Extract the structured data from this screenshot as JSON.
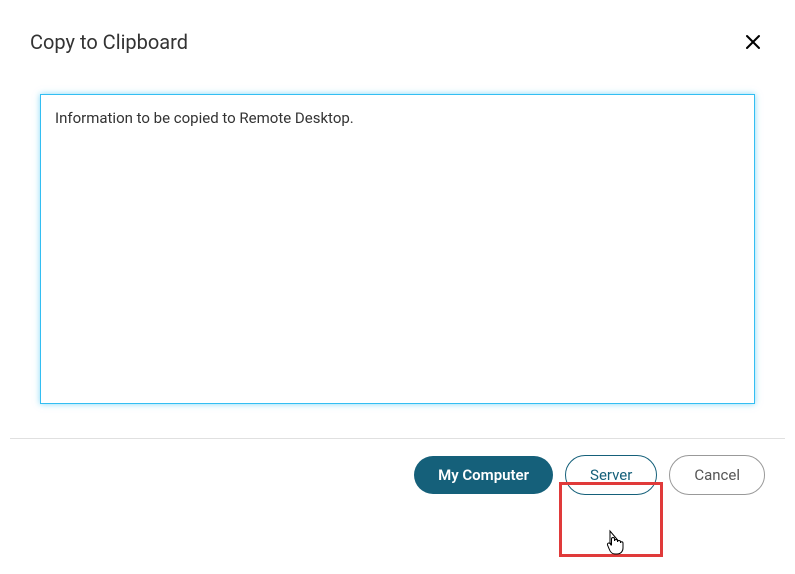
{
  "dialog": {
    "title": "Copy to Clipboard"
  },
  "textarea": {
    "value": "Information to be copied to Remote Desktop."
  },
  "buttons": {
    "my_computer": "My Computer",
    "server": "Server",
    "cancel": "Cancel"
  }
}
